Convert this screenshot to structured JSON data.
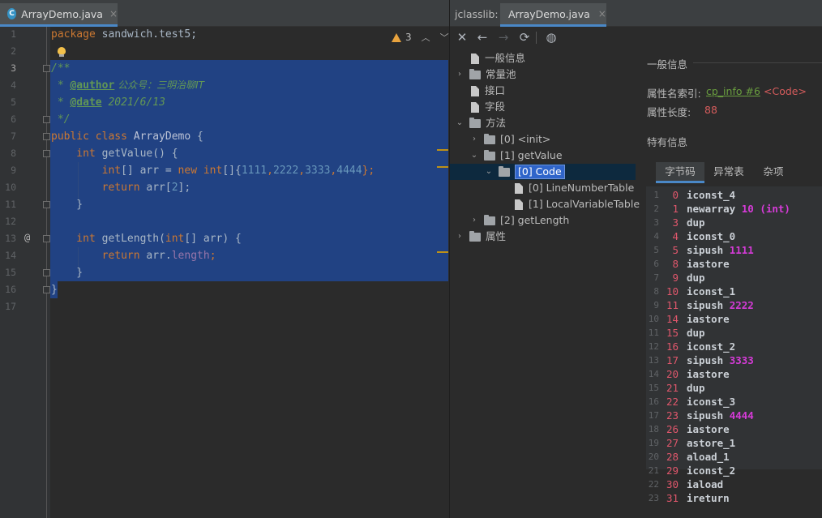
{
  "editor": {
    "tab": {
      "icon": "C",
      "label": "ArrayDemo.java",
      "close": "×"
    },
    "inspection": {
      "count": "3"
    },
    "line_numbers": [
      "1",
      "2",
      "3",
      "4",
      "5",
      "6",
      "7",
      "8",
      "9",
      "10",
      "11",
      "12",
      "13",
      "14",
      "15",
      "16",
      "17"
    ],
    "gutter_at": "@",
    "code": {
      "l1_kw": "package",
      "l1_rest": " sandwich.test5;",
      "l3": "/**",
      "l4_pre": " * ",
      "l4_tag": "@author",
      "l4_text": " 公众号：三明治聊IT",
      "l5_pre": " * ",
      "l5_tag": "@date",
      "l5_text": " 2021/6/13",
      "l6": " */",
      "l7_kw": "public class",
      "l7_name": " ArrayDemo",
      "l7_rest": " {",
      "l8_kw": "    int",
      "l8_fn": " getValue",
      "l8_rest": "() {",
      "l9_kw": "        int",
      "l9_a": "[] arr = ",
      "l9_new": "new",
      "l9_int": " int",
      "l9_b": "[]{",
      "l9_n1": "1111",
      "l9_c1": ",",
      "l9_n2": "2222",
      "l9_c2": ",",
      "l9_n3": "3333",
      "l9_c3": ",",
      "l9_n4": "4444",
      "l9_end": "};",
      "l10_kw": "        return",
      "l10_a": " arr[",
      "l10_n": "2",
      "l10_end": "];",
      "l11": "    }",
      "l13_kw": "    int",
      "l13_fn": " getLength",
      "l13_a": "(",
      "l13_int": "int",
      "l13_b": "[] arr) {",
      "l14_kw": "        return",
      "l14_a": " arr.",
      "l14_fld": "length",
      "l14_end": ";",
      "l15": "    }",
      "l16": "}"
    }
  },
  "jclasslib": {
    "title": "jclasslib:",
    "tab": {
      "label": "ArrayDemo.java",
      "close": "×"
    },
    "toolbar": {
      "close": "✕",
      "back": "←",
      "forward": "→",
      "refresh": "⟳",
      "web": "◍"
    },
    "tree": [
      {
        "label": "一般信息",
        "kind": "file"
      },
      {
        "label": "常量池",
        "kind": "folder",
        "chev": "›"
      },
      {
        "label": "接口",
        "kind": "file"
      },
      {
        "label": "字段",
        "kind": "file"
      },
      {
        "label": "方法",
        "kind": "folder",
        "chev": "⌄"
      },
      {
        "label": "[0] <init>",
        "kind": "folder",
        "chev": "›"
      },
      {
        "label": "[1] getValue",
        "kind": "folder",
        "chev": "⌄"
      },
      {
        "label": "[0] Code",
        "kind": "folder",
        "chev": "⌄"
      },
      {
        "label": "[0] LineNumberTable",
        "kind": "file"
      },
      {
        "label": "[1] LocalVariableTable",
        "kind": "file"
      },
      {
        "label": "[2] getLength",
        "kind": "folder",
        "chev": "›"
      },
      {
        "label": "属性",
        "kind": "folder",
        "chev": "›"
      }
    ],
    "general": {
      "title": "一般信息",
      "name_index_label": "属性名索引:",
      "name_index_link": "cp_info #6",
      "name_index_value": "<Code>",
      "length_label": "属性长度:",
      "length_value": "88"
    },
    "specific_title": "特有信息",
    "bytecode_tabs": [
      "字节码",
      "异常表",
      "杂项"
    ],
    "bytecode": [
      {
        "ln": "1",
        "off": "0",
        "op": "iconst_4",
        "arg": ""
      },
      {
        "ln": "2",
        "off": "1",
        "op": "newarray",
        "arg": "10 (int)"
      },
      {
        "ln": "3",
        "off": "3",
        "op": "dup",
        "arg": ""
      },
      {
        "ln": "4",
        "off": "4",
        "op": "iconst_0",
        "arg": ""
      },
      {
        "ln": "5",
        "off": "5",
        "op": "sipush",
        "arg": "1111"
      },
      {
        "ln": "6",
        "off": "8",
        "op": "iastore",
        "arg": ""
      },
      {
        "ln": "7",
        "off": "9",
        "op": "dup",
        "arg": ""
      },
      {
        "ln": "8",
        "off": "10",
        "op": "iconst_1",
        "arg": ""
      },
      {
        "ln": "9",
        "off": "11",
        "op": "sipush",
        "arg": "2222"
      },
      {
        "ln": "10",
        "off": "14",
        "op": "iastore",
        "arg": ""
      },
      {
        "ln": "11",
        "off": "15",
        "op": "dup",
        "arg": ""
      },
      {
        "ln": "12",
        "off": "16",
        "op": "iconst_2",
        "arg": ""
      },
      {
        "ln": "13",
        "off": "17",
        "op": "sipush",
        "arg": "3333"
      },
      {
        "ln": "14",
        "off": "20",
        "op": "iastore",
        "arg": ""
      },
      {
        "ln": "15",
        "off": "21",
        "op": "dup",
        "arg": ""
      },
      {
        "ln": "16",
        "off": "22",
        "op": "iconst_3",
        "arg": ""
      },
      {
        "ln": "17",
        "off": "23",
        "op": "sipush",
        "arg": "4444"
      },
      {
        "ln": "18",
        "off": "26",
        "op": "iastore",
        "arg": ""
      },
      {
        "ln": "19",
        "off": "27",
        "op": "astore_1",
        "arg": ""
      },
      {
        "ln": "20",
        "off": "28",
        "op": "aload_1",
        "arg": ""
      },
      {
        "ln": "21",
        "off": "29",
        "op": "iconst_2",
        "arg": ""
      },
      {
        "ln": "22",
        "off": "30",
        "op": "iaload",
        "arg": ""
      },
      {
        "ln": "23",
        "off": "31",
        "op": "ireturn",
        "arg": ""
      }
    ]
  }
}
